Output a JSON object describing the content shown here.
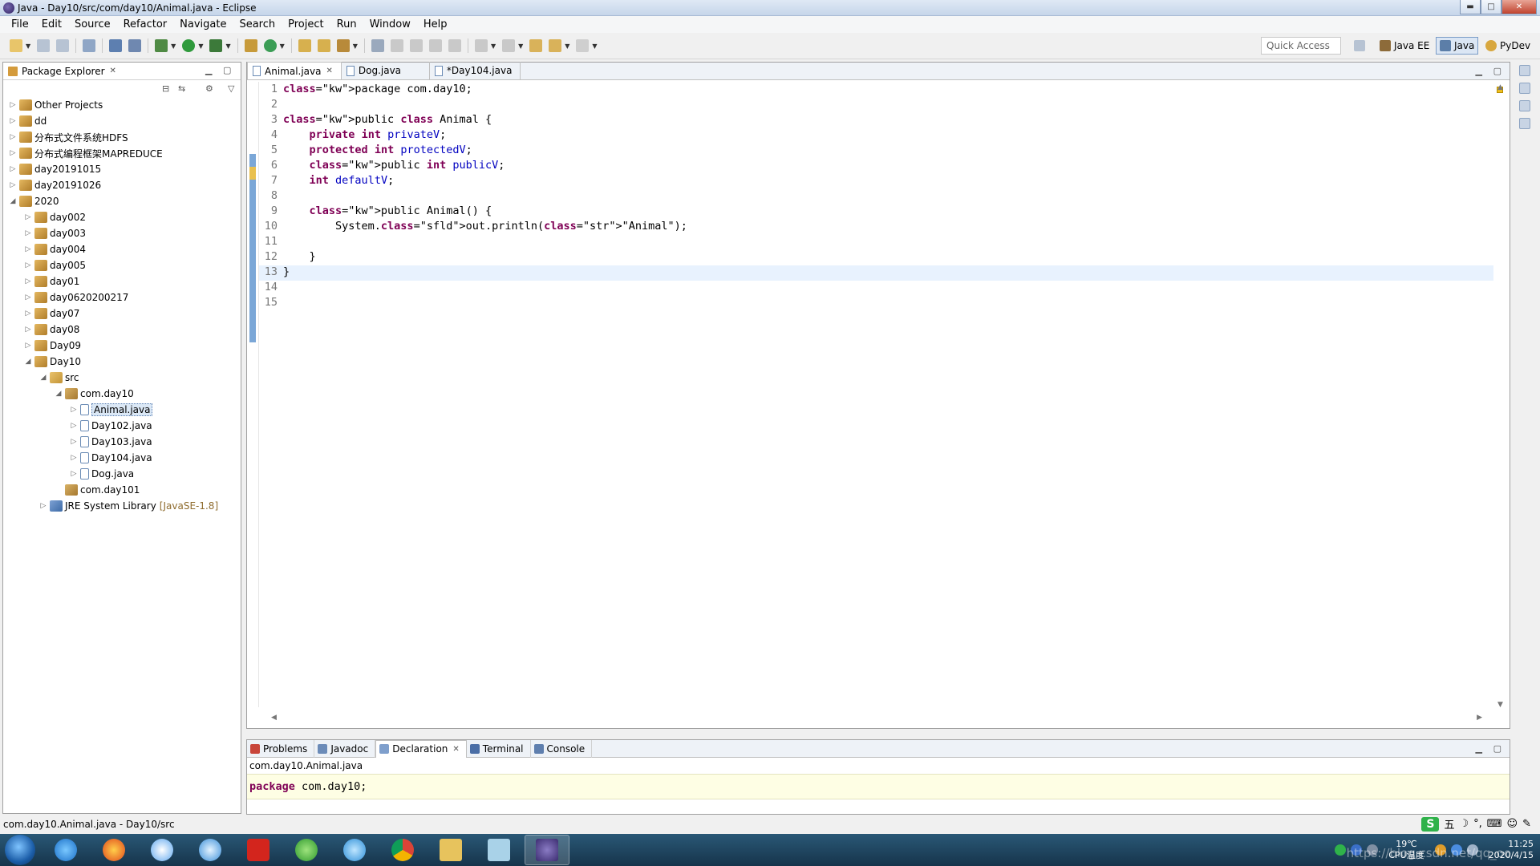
{
  "window": {
    "title": "Java - Day10/src/com/day10/Animal.java - Eclipse"
  },
  "menu": [
    "File",
    "Edit",
    "Source",
    "Refactor",
    "Navigate",
    "Search",
    "Project",
    "Run",
    "Window",
    "Help"
  ],
  "toolbar": {
    "quick_access_placeholder": "Quick Access",
    "perspectives": [
      "Java EE",
      "Java",
      "PyDev"
    ],
    "active_perspective": "Java"
  },
  "package_explorer": {
    "title": "Package Explorer",
    "tree": [
      {
        "label": "Other Projects",
        "level": 0,
        "expanded": false,
        "kind": "proj"
      },
      {
        "label": "dd",
        "level": 0,
        "expanded": false,
        "kind": "proj"
      },
      {
        "label": "分布式文件系统HDFS",
        "level": 0,
        "expanded": false,
        "kind": "proj"
      },
      {
        "label": "分布式编程框架MAPREDUCE",
        "level": 0,
        "expanded": false,
        "kind": "proj"
      },
      {
        "label": "day20191015",
        "level": 0,
        "expanded": false,
        "kind": "proj"
      },
      {
        "label": "day20191026",
        "level": 0,
        "expanded": false,
        "kind": "proj"
      },
      {
        "label": "2020",
        "level": 0,
        "expanded": true,
        "kind": "proj"
      },
      {
        "label": "day002",
        "level": 1,
        "expanded": false,
        "kind": "proj"
      },
      {
        "label": "day003",
        "level": 1,
        "expanded": false,
        "kind": "proj"
      },
      {
        "label": "day004",
        "level": 1,
        "expanded": false,
        "kind": "proj"
      },
      {
        "label": "day005",
        "level": 1,
        "expanded": false,
        "kind": "proj"
      },
      {
        "label": "day01",
        "level": 1,
        "expanded": false,
        "kind": "proj"
      },
      {
        "label": "day0620200217",
        "level": 1,
        "expanded": false,
        "kind": "proj"
      },
      {
        "label": "day07",
        "level": 1,
        "expanded": false,
        "kind": "proj"
      },
      {
        "label": "day08",
        "level": 1,
        "expanded": false,
        "kind": "proj"
      },
      {
        "label": "Day09",
        "level": 1,
        "expanded": false,
        "kind": "proj"
      },
      {
        "label": "Day10",
        "level": 1,
        "expanded": true,
        "kind": "proj"
      },
      {
        "label": "src",
        "level": 2,
        "expanded": true,
        "kind": "srcf"
      },
      {
        "label": "com.day10",
        "level": 3,
        "expanded": true,
        "kind": "pkgi"
      },
      {
        "label": "Animal.java",
        "level": 4,
        "expanded": false,
        "kind": "java",
        "selected": true
      },
      {
        "label": "Day102.java",
        "level": 4,
        "expanded": false,
        "kind": "java"
      },
      {
        "label": "Day103.java",
        "level": 4,
        "expanded": false,
        "kind": "java"
      },
      {
        "label": "Day104.java",
        "level": 4,
        "expanded": false,
        "kind": "java"
      },
      {
        "label": "Dog.java",
        "level": 4,
        "expanded": false,
        "kind": "java"
      },
      {
        "label": "com.day101",
        "level": 3,
        "expanded": null,
        "kind": "pkgi"
      },
      {
        "label": "JRE System Library",
        "level": 2,
        "expanded": false,
        "kind": "jre",
        "suffix": "[JavaSE-1.8]"
      }
    ]
  },
  "editor": {
    "tabs": [
      {
        "label": "Animal.java",
        "active": true,
        "closable": true
      },
      {
        "label": "Dog.java",
        "active": false
      },
      {
        "label": "*Day104.java",
        "active": false
      }
    ],
    "line_numbers": [
      "1",
      "2",
      "3",
      "4",
      "5",
      "6",
      "7",
      "8",
      "9",
      "10",
      "11",
      "12",
      "13",
      "14",
      "15"
    ],
    "code_lines": [
      "package com.day10;",
      "",
      "public class Animal {",
      "    private int privateV;",
      "    protected int protectedV;",
      "    public int publicV;",
      "    int defaultV;",
      "",
      "    public Animal() {",
      "        System.out.println(\"Animal\");",
      "",
      "    }",
      "}",
      "",
      ""
    ]
  },
  "bottom_panel": {
    "tabs": [
      "Problems",
      "Javadoc",
      "Declaration",
      "Terminal",
      "Console"
    ],
    "active_tab": "Declaration",
    "declaration_path": "com.day10.Animal.java",
    "declaration_code": "package com.day10;"
  },
  "status_bar": {
    "text": "com.day10.Animal.java - Day10/src"
  },
  "ime": {
    "mode": "五"
  },
  "taskbar": {
    "temperature": "19℃",
    "temperature_label": "CPU温度",
    "time": "11:25",
    "date": "2020/4/15",
    "watermark": "https://blog.csdn.net/qq_oo"
  },
  "colors": {
    "keyword": "#7f0055",
    "field": "#0000c0",
    "string": "#2a00ff",
    "current_line": "#e8f2fe",
    "declaration_bg": "#fefee4"
  }
}
